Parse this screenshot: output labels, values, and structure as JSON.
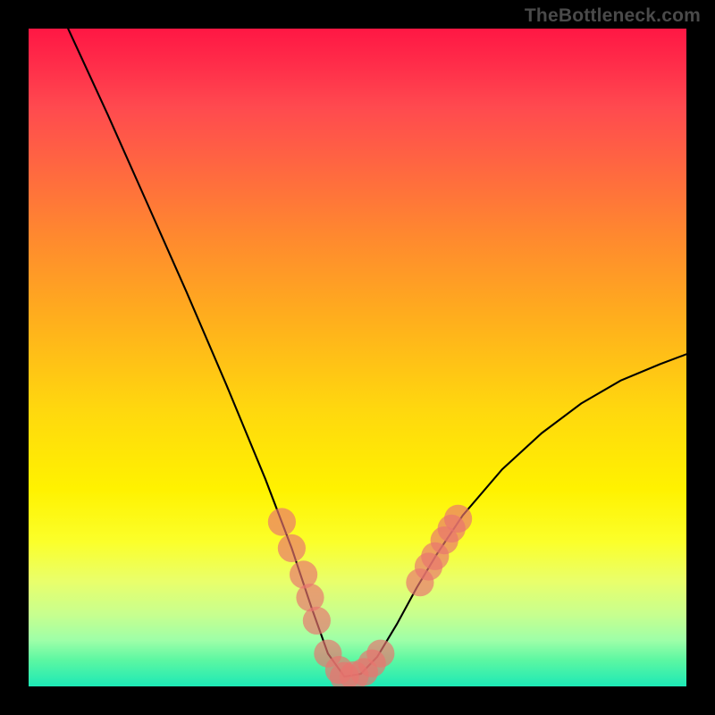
{
  "watermark_text": "TheBottleneck.com",
  "colors": {
    "frame": "#000000",
    "curve": "#000000",
    "marker": "#e9746f",
    "gradient_stops": [
      "#ff1744",
      "#ff2f4a",
      "#ff4a4f",
      "#ff6a3f",
      "#ff8a2e",
      "#ffae1d",
      "#ffd80e",
      "#fff200",
      "#fbff2a",
      "#e9ff6b",
      "#c8ff8e",
      "#9effa8",
      "#5cf7a2",
      "#1de9b6"
    ]
  },
  "chart_data": {
    "type": "line",
    "title": "",
    "xlabel": "",
    "ylabel": "",
    "xlim": [
      0,
      100
    ],
    "ylim": [
      0,
      100
    ],
    "note": "Apparent CPU↔GPU bottleneck curve from TheBottleneck.com. Axes are unlabeled. Values estimated from pixel positions; y=0 at bottom (green) and y=100 at top (red). Curve is a V with minimum near x≈48. Left branch is steep and nearly linear; right branch rises and begins to level off near the upper-middle.",
    "series": [
      {
        "name": "bottleneck-curve",
        "points": [
          {
            "x": 6.0,
            "y": 100.0
          },
          {
            "x": 12.0,
            "y": 87.0
          },
          {
            "x": 18.0,
            "y": 73.5
          },
          {
            "x": 24.0,
            "y": 60.0
          },
          {
            "x": 30.0,
            "y": 46.0
          },
          {
            "x": 36.0,
            "y": 31.5
          },
          {
            "x": 40.0,
            "y": 21.0
          },
          {
            "x": 43.0,
            "y": 12.0
          },
          {
            "x": 45.5,
            "y": 5.0
          },
          {
            "x": 48.0,
            "y": 1.5
          },
          {
            "x": 50.5,
            "y": 1.9
          },
          {
            "x": 53.0,
            "y": 4.5
          },
          {
            "x": 56.0,
            "y": 9.5
          },
          {
            "x": 59.0,
            "y": 15.0
          },
          {
            "x": 62.0,
            "y": 20.0
          },
          {
            "x": 66.0,
            "y": 26.0
          },
          {
            "x": 72.0,
            "y": 33.0
          },
          {
            "x": 78.0,
            "y": 38.5
          },
          {
            "x": 84.0,
            "y": 43.0
          },
          {
            "x": 90.0,
            "y": 46.5
          },
          {
            "x": 96.0,
            "y": 49.0
          },
          {
            "x": 100.0,
            "y": 50.5
          }
        ]
      }
    ],
    "markers": {
      "name": "highlighted-points",
      "note": "Salmon semi-transparent dots clustered near valley and lower branches.",
      "points": [
        {
          "x": 38.5,
          "y": 25.0,
          "r": 1.6
        },
        {
          "x": 40.0,
          "y": 21.0,
          "r": 1.6
        },
        {
          "x": 41.8,
          "y": 17.0,
          "r": 1.6
        },
        {
          "x": 42.8,
          "y": 13.5,
          "r": 1.6
        },
        {
          "x": 43.8,
          "y": 10.0,
          "r": 1.6
        },
        {
          "x": 45.5,
          "y": 5.0,
          "r": 1.6
        },
        {
          "x": 47.2,
          "y": 2.5,
          "r": 1.6
        },
        {
          "x": 48.0,
          "y": 1.5,
          "r": 1.7
        },
        {
          "x": 49.5,
          "y": 1.6,
          "r": 1.7
        },
        {
          "x": 51.0,
          "y": 2.2,
          "r": 1.6
        },
        {
          "x": 52.2,
          "y": 3.5,
          "r": 1.6
        },
        {
          "x": 53.5,
          "y": 5.0,
          "r": 1.6
        },
        {
          "x": 59.5,
          "y": 15.8,
          "r": 1.6
        },
        {
          "x": 60.8,
          "y": 18.2,
          "r": 1.6
        },
        {
          "x": 61.8,
          "y": 19.8,
          "r": 1.6
        },
        {
          "x": 63.2,
          "y": 22.2,
          "r": 1.6
        },
        {
          "x": 64.3,
          "y": 24.0,
          "r": 1.6
        },
        {
          "x": 65.3,
          "y": 25.5,
          "r": 1.6
        }
      ]
    }
  }
}
